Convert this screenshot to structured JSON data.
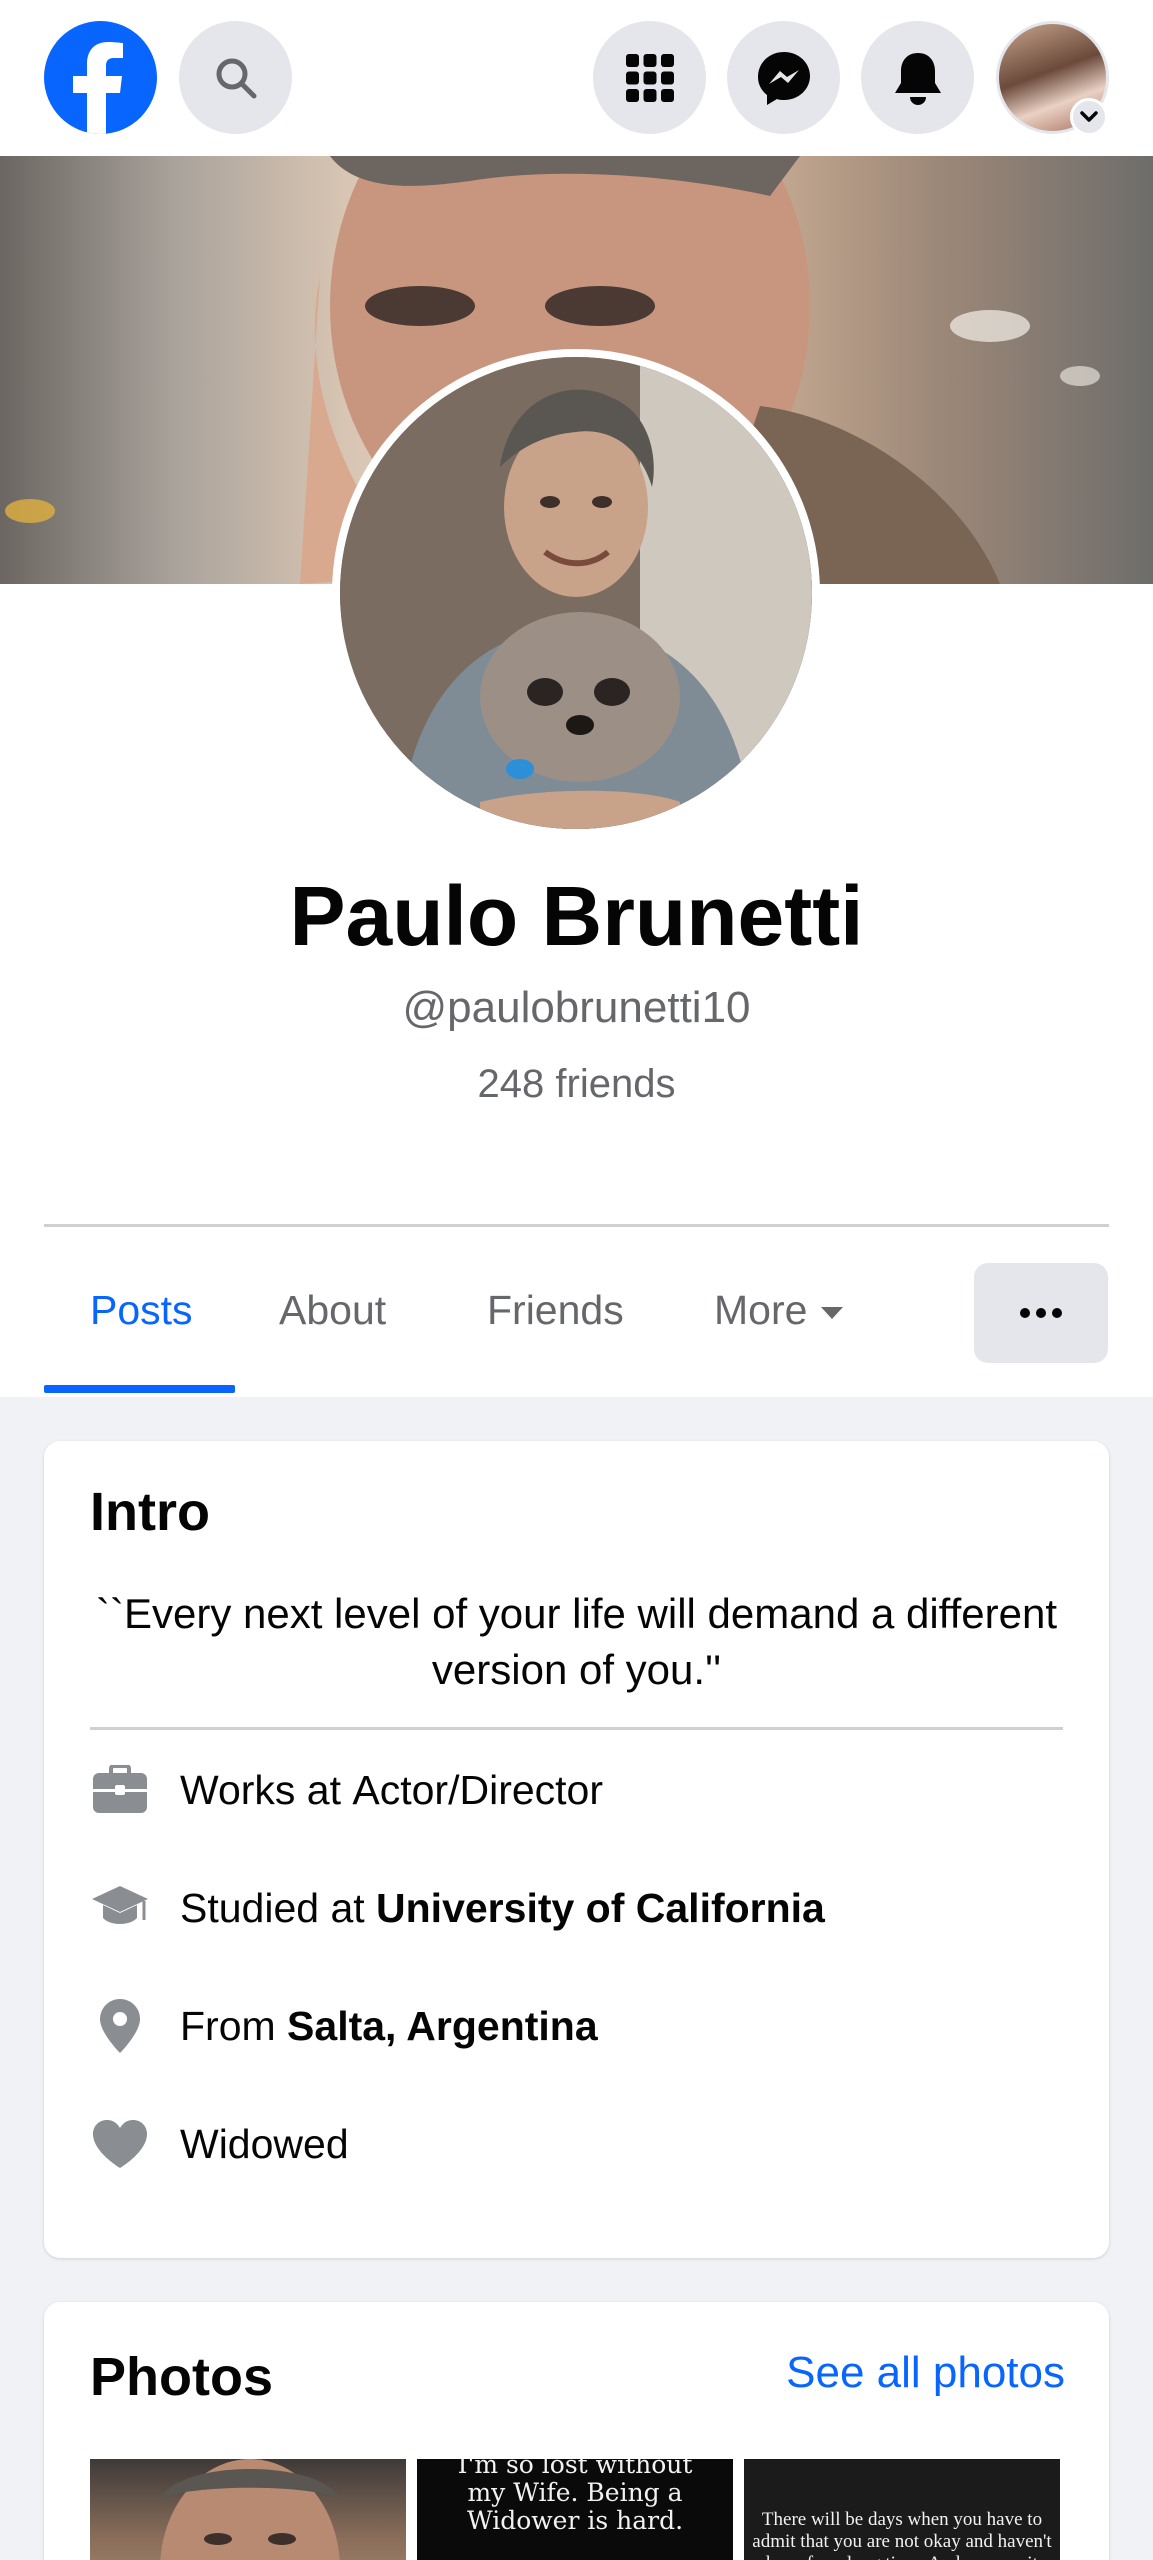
{
  "topbar": {
    "icons": [
      "facebook-logo",
      "search-icon",
      "menu-grid-icon",
      "messenger-icon",
      "bell-icon",
      "avatar",
      "chevron-down-icon"
    ]
  },
  "profile": {
    "name": "Paulo Brunetti",
    "handle": "@paulobrunetti10",
    "friends": "248 friends"
  },
  "tabs": {
    "posts": "Posts",
    "about": "About",
    "friends": "Friends",
    "more": "More",
    "active": "Posts"
  },
  "intro": {
    "title": "Intro",
    "bio": "``Every next level of your life will demand a different version of you.''",
    "work_prefix": "Works at ",
    "work_value": "Actor/Director",
    "study_prefix": "Studied at ",
    "study_value": "University of California",
    "from_prefix": "From ",
    "from_value": "Salta, Argentina",
    "relationship": "Widowed"
  },
  "photos": {
    "title": "Photos",
    "see_all": "See all photos",
    "photo2_text": "I'm so lost without my Wife. Being a Widower is hard.",
    "photo3_text": "There will be days when you have to admit that you are not okay and haven't been for a long time. And you cry it out"
  },
  "colors": {
    "brand": "#0866ff",
    "text_secondary": "#65676b",
    "button_bg": "#e4e6eb"
  }
}
